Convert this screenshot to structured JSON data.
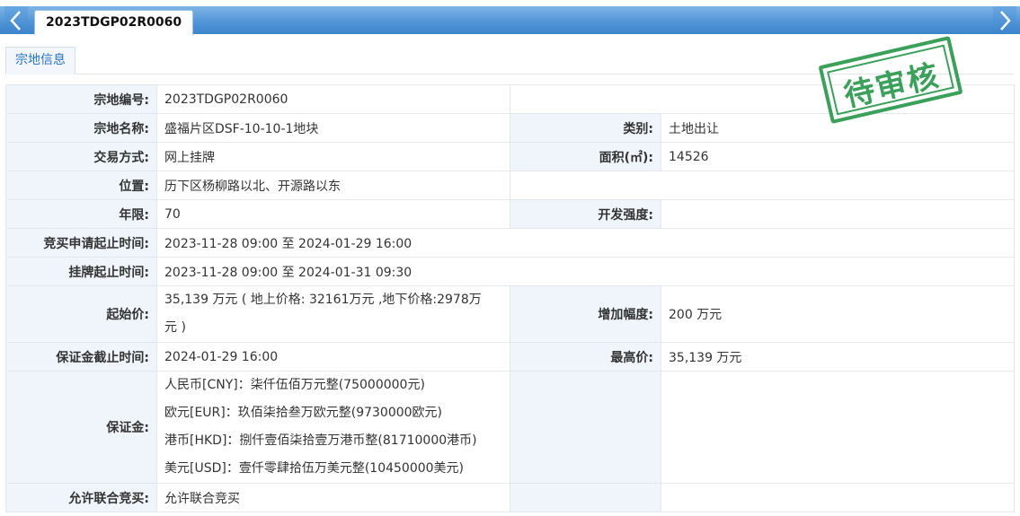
{
  "tabbar": {
    "active_tab": "2023TDGP02R0060",
    "prev_icon": "chevron-left-icon",
    "next_icon": "chevron-right-icon"
  },
  "section_tab": "宗地信息",
  "stamp": "待审核",
  "fields": {
    "parcel_no_label": "宗地编号:",
    "parcel_no": "2023TDGP02R0060",
    "parcel_name_label": "宗地名称:",
    "parcel_name": "盛福片区DSF-10-10-1地块",
    "category_label": "类别:",
    "category": "土地出让",
    "trade_method_label": "交易方式:",
    "trade_method": "网上挂牌",
    "area_label": "面积(㎡):",
    "area": "14526",
    "location_label": "位置:",
    "location": "历下区杨柳路以北、开源路以东",
    "term_label": "年限:",
    "term": "70",
    "intensity_label": "开发强度:",
    "intensity": "",
    "bid_apply_label": "竞买申请起止时间:",
    "bid_apply": "2023-11-28 09:00 至 2024-01-29 16:00",
    "listing_label": "挂牌起止时间:",
    "listing": "2023-11-28 09:00 至 2024-01-31 09:30",
    "start_price_label": "起始价:",
    "start_price_line1": "35,139 万元 ( 地上价格: 32161万元 ,地下价格:2978万",
    "start_price_line2": "元 )",
    "increment_label": "增加幅度:",
    "increment": "200 万元",
    "deposit_deadline_label": "保证金截止时间:",
    "deposit_deadline": "2024-01-29 16:00",
    "max_price_label": "最高价:",
    "max_price": "35,139 万元",
    "deposit_label": "保证金:",
    "deposit_cny": "人民币[CNY]：柒仟伍佰万元整(75000000元)",
    "deposit_eur": "欧元[EUR]：玖佰柒拾叁万欧元整(9730000欧元)",
    "deposit_hkd": "港币[HKD]：捌仟壹佰柒拾壹万港币整(81710000港币)",
    "deposit_usd": "美元[USD]：壹仟零肆拾伍万美元整(10450000美元)",
    "joint_bid_label": "允许联合竞买:",
    "joint_bid": "允许联合竞买"
  }
}
